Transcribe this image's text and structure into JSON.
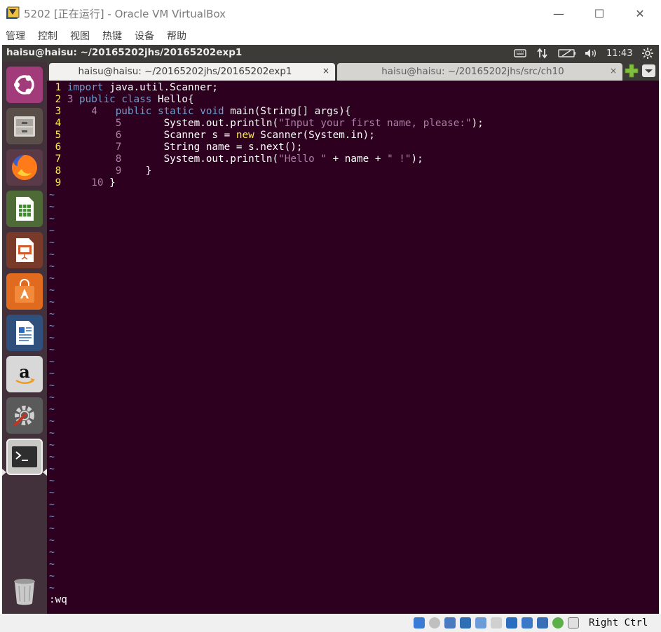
{
  "window": {
    "title": "5202 [正在运行] - Oracle VM VirtualBox",
    "minimize_glyph": "—",
    "maximize_glyph": "☐",
    "close_glyph": "✕"
  },
  "menu": [
    "管理",
    "控制",
    "视图",
    "热键",
    "设备",
    "帮助"
  ],
  "panel": {
    "title": "haisu@haisu: ~/20165202jhs/20165202exp1",
    "time": "11:43"
  },
  "tabs": [
    {
      "label": "haisu@haisu: ~/20165202jhs/20165202exp1",
      "close": "×",
      "active": true
    },
    {
      "label": "haisu@haisu: ~/20165202jhs/src/ch10",
      "close": "×",
      "active": false
    }
  ],
  "code": [
    {
      "n": "1",
      "parts": [
        [
          "kw",
          "import"
        ],
        [
          "",
          " java.util.Scanner;"
        ]
      ]
    },
    {
      "n": "2",
      "parts": [
        [
          "inner",
          "3 "
        ],
        [
          "kw",
          "public"
        ],
        [
          "",
          " "
        ],
        [
          "kw",
          "class"
        ],
        [
          "",
          " Hello{"
        ]
      ]
    },
    {
      "n": "3",
      "parts": [
        [
          "inner",
          "    4   "
        ],
        [
          "kw",
          "public"
        ],
        [
          "",
          " "
        ],
        [
          "kw",
          "static"
        ],
        [
          "",
          " "
        ],
        [
          "ty",
          "void"
        ],
        [
          "",
          " main(String[] args){"
        ]
      ]
    },
    {
      "n": "4",
      "parts": [
        [
          "inner",
          "        5       "
        ],
        [
          "",
          "System.out.println("
        ],
        [
          "str",
          "\"Input your first name, please:\""
        ],
        [
          "",
          ");"
        ]
      ]
    },
    {
      "n": "5",
      "parts": [
        [
          "inner",
          "        6       "
        ],
        [
          "",
          "Scanner s = "
        ],
        [
          "new",
          "new"
        ],
        [
          "",
          " Scanner(System.in);"
        ]
      ]
    },
    {
      "n": "6",
      "parts": [
        [
          "inner",
          "        7       "
        ],
        [
          "",
          "String name = s.next();"
        ]
      ]
    },
    {
      "n": "7",
      "parts": [
        [
          "inner",
          "        8       "
        ],
        [
          "",
          "System.out.println("
        ],
        [
          "str",
          "\"Hello \""
        ],
        [
          "",
          " + name + "
        ],
        [
          "str",
          "\" !\""
        ],
        [
          "",
          ");"
        ]
      ]
    },
    {
      "n": "8",
      "parts": [
        [
          "inner",
          "        9   "
        ],
        [
          "",
          " }"
        ]
      ]
    },
    {
      "n": "9",
      "parts": [
        [
          "inner",
          "    10 "
        ],
        [
          "",
          "}"
        ]
      ]
    }
  ],
  "empty_line_marker": "~",
  "command_line": ":wq",
  "statusbar": {
    "host_key": "Right Ctrl"
  },
  "launcher_items": [
    "ubuntu-dash",
    "files",
    "firefox",
    "libreoffice-calc",
    "libreoffice-impress",
    "ubuntu-software",
    "libreoffice-writer",
    "amazon",
    "system-settings",
    "terminal",
    "trash"
  ]
}
